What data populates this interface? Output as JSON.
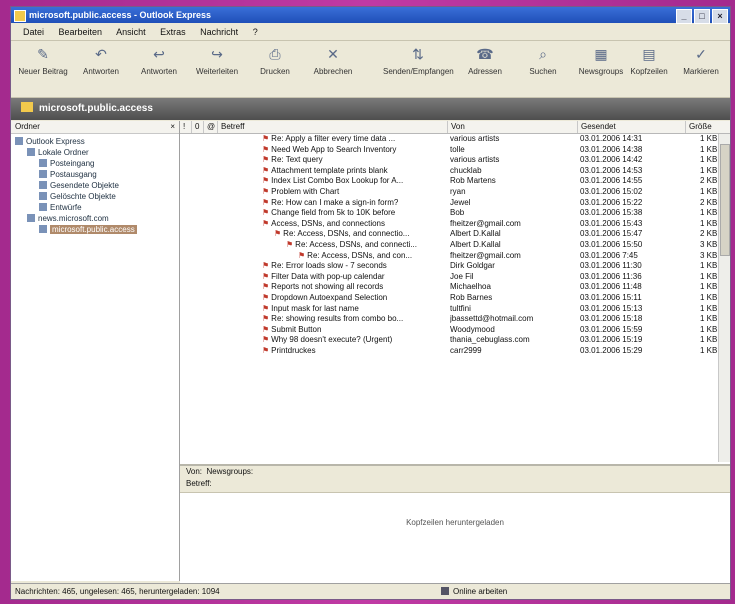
{
  "window": {
    "title": "microsoft.public.access - Outlook Express"
  },
  "menu": [
    "Datei",
    "Bearbeiten",
    "Ansicht",
    "Extras",
    "Nachricht",
    "?"
  ],
  "toolbar": [
    {
      "label": "Neuer Beitrag",
      "icon": "new-post-icon"
    },
    {
      "label": "Antworten",
      "icon": "reply-group-icon"
    },
    {
      "label": "Antworten",
      "icon": "reply-icon"
    },
    {
      "label": "Weiterleiten",
      "icon": "forward-icon"
    },
    {
      "label": "Drucken",
      "icon": "print-icon"
    },
    {
      "label": "Abbrechen",
      "icon": "stop-icon"
    },
    {
      "label": "Senden/Empfangen",
      "icon": "send-receive-icon"
    },
    {
      "label": "Adressen",
      "icon": "addresses-icon"
    },
    {
      "label": "Suchen",
      "icon": "find-icon"
    },
    {
      "label": "Newsgroups",
      "icon": "newsgroups-icon"
    },
    {
      "label": "Kopfzeilen",
      "icon": "headers-icon"
    },
    {
      "label": "Markieren",
      "icon": "markup-icon"
    }
  ],
  "address_bar": {
    "title": "microsoft.public.access"
  },
  "folders": {
    "header": "Ordner",
    "items": [
      {
        "label": "Outlook Express",
        "indent": 0
      },
      {
        "label": "Lokale Ordner",
        "indent": 1
      },
      {
        "label": "Posteingang",
        "indent": 2
      },
      {
        "label": "Postausgang",
        "indent": 2
      },
      {
        "label": "Gesendete Objekte",
        "indent": 2
      },
      {
        "label": "Gelöschte Objekte",
        "indent": 2
      },
      {
        "label": "Entwürfe",
        "indent": 2
      },
      {
        "label": "news.microsoft.com",
        "indent": 1
      },
      {
        "label": "microsoft.public.access",
        "indent": 2,
        "selected": true
      }
    ]
  },
  "list": {
    "columns": [
      "!",
      "0",
      "@",
      "Betreff",
      "Von",
      "Gesendet",
      "Größe"
    ],
    "rows": [
      {
        "subject": "Re: Apply a filter every time data ...",
        "from": "various artists",
        "date": "03.01.2006 14:31",
        "size": "1 KB",
        "level": 0
      },
      {
        "subject": "Need Web App to Search Inventory",
        "from": "tolle",
        "date": "03.01.2006 14:38",
        "size": "1 KB",
        "level": 0
      },
      {
        "subject": "Re: Text query",
        "from": "various artists",
        "date": "03.01.2006 14:42",
        "size": "1 KB",
        "level": 0
      },
      {
        "subject": "Attachment template prints blank",
        "from": "chucklab",
        "date": "03.01.2006 14:53",
        "size": "1 KB",
        "level": 0
      },
      {
        "subject": "Index List Combo Box Lookup for A...",
        "from": "Rob Martens",
        "date": "03.01.2006 14:55",
        "size": "2 KB",
        "level": 0
      },
      {
        "subject": "Problem with Chart",
        "from": "ryan",
        "date": "03.01.2006 15:02",
        "size": "1 KB",
        "level": 0
      },
      {
        "subject": "Re: How can I make a sign-in form?",
        "from": "Jewel",
        "date": "03.01.2006 15:22",
        "size": "2 KB",
        "level": 0
      },
      {
        "subject": "Change field from 5k to 10K before",
        "from": "Bob",
        "date": "03.01.2006 15:38",
        "size": "1 KB",
        "level": 0
      },
      {
        "subject": "Access, DSNs, and connections",
        "from": "fheitzer@gmail.com",
        "date": "03.01.2006 15:43",
        "size": "1 KB",
        "level": 0
      },
      {
        "subject": "Re: Access, DSNs, and connectio...",
        "from": "Albert D.Kallal",
        "date": "03.01.2006 15:47",
        "size": "2 KB",
        "level": 1
      },
      {
        "subject": "Re: Access, DSNs, and connecti...",
        "from": "Albert D.Kallal",
        "date": "03.01.2006 15:50",
        "size": "3 KB",
        "level": 2
      },
      {
        "subject": "Re: Access, DSNs, and con...",
        "from": "fheitzer@gmail.com",
        "date": "03.01.2006 7:45",
        "size": "3 KB",
        "level": 3
      },
      {
        "subject": "Re: Error loads slow - 7 seconds",
        "from": "Dirk Goldgar",
        "date": "03.01.2006 11:30",
        "size": "1 KB",
        "level": 0
      },
      {
        "subject": "Filter Data with pop-up calendar",
        "from": "Joe Fil",
        "date": "03.01.2006 11:36",
        "size": "1 KB",
        "level": 0
      },
      {
        "subject": "Reports not showing all records",
        "from": "Michaelhoa",
        "date": "03.01.2006 11:48",
        "size": "1 KB",
        "level": 0
      },
      {
        "subject": "Dropdown Autoexpand Selection",
        "from": "Rob Barnes",
        "date": "03.01.2006 15:11",
        "size": "1 KB",
        "level": 0
      },
      {
        "subject": "Input mask for last name",
        "from": "tultfini",
        "date": "03.01.2006 15:13",
        "size": "1 KB",
        "level": 0
      },
      {
        "subject": "Re: showing results from combo bo...",
        "from": "jbassettd@hotmail.com",
        "date": "03.01.2006 15:18",
        "size": "1 KB",
        "level": 0
      },
      {
        "subject": "Submit Button",
        "from": "Woodymood",
        "date": "03.01.2006 15:59",
        "size": "1 KB",
        "level": 0
      },
      {
        "subject": "Why 98 doesn't execute? (Urgent)",
        "from": "thania_cebuglass.com",
        "date": "03.01.2006 15:19",
        "size": "1 KB",
        "level": 0
      },
      {
        "subject": "Printdruckes",
        "from": "carr2999",
        "date": "03.01.2006 15:29",
        "size": "1 KB",
        "level": 0
      }
    ]
  },
  "preview": {
    "from_label": "Von:",
    "to_label": "Newsgroups:",
    "subject_label": "Betreff:",
    "message": "Kopfzeilen heruntergeladen"
  },
  "status": {
    "left": "Nachrichten: 465, ungelesen: 465, heruntergeladen: 1094",
    "right": "Online arbeiten"
  }
}
